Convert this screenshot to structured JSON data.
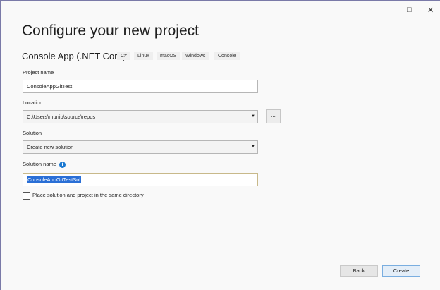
{
  "window": {
    "maximize_icon": "□",
    "close_icon": "✕"
  },
  "title": "Configure your new project",
  "template": {
    "name": "Console App (.NET Core)",
    "tags": [
      "C#",
      "Linux",
      "macOS",
      "Windows",
      "Console"
    ]
  },
  "project_name": {
    "label": "Project name",
    "value": "ConsoleAppGitTest"
  },
  "location": {
    "label": "Location",
    "value": "C:\\Users\\munib\\source\\repos",
    "browse_label": "..."
  },
  "solution": {
    "label": "Solution",
    "value": "Create new solution"
  },
  "solution_name": {
    "label": "Solution name",
    "value": "ConsoleAppGitTestSol",
    "info_icon": "i"
  },
  "same_directory": {
    "label": "Place solution and project in the same directory",
    "checked": false
  },
  "buttons": {
    "back": "Back",
    "create": "Create"
  }
}
